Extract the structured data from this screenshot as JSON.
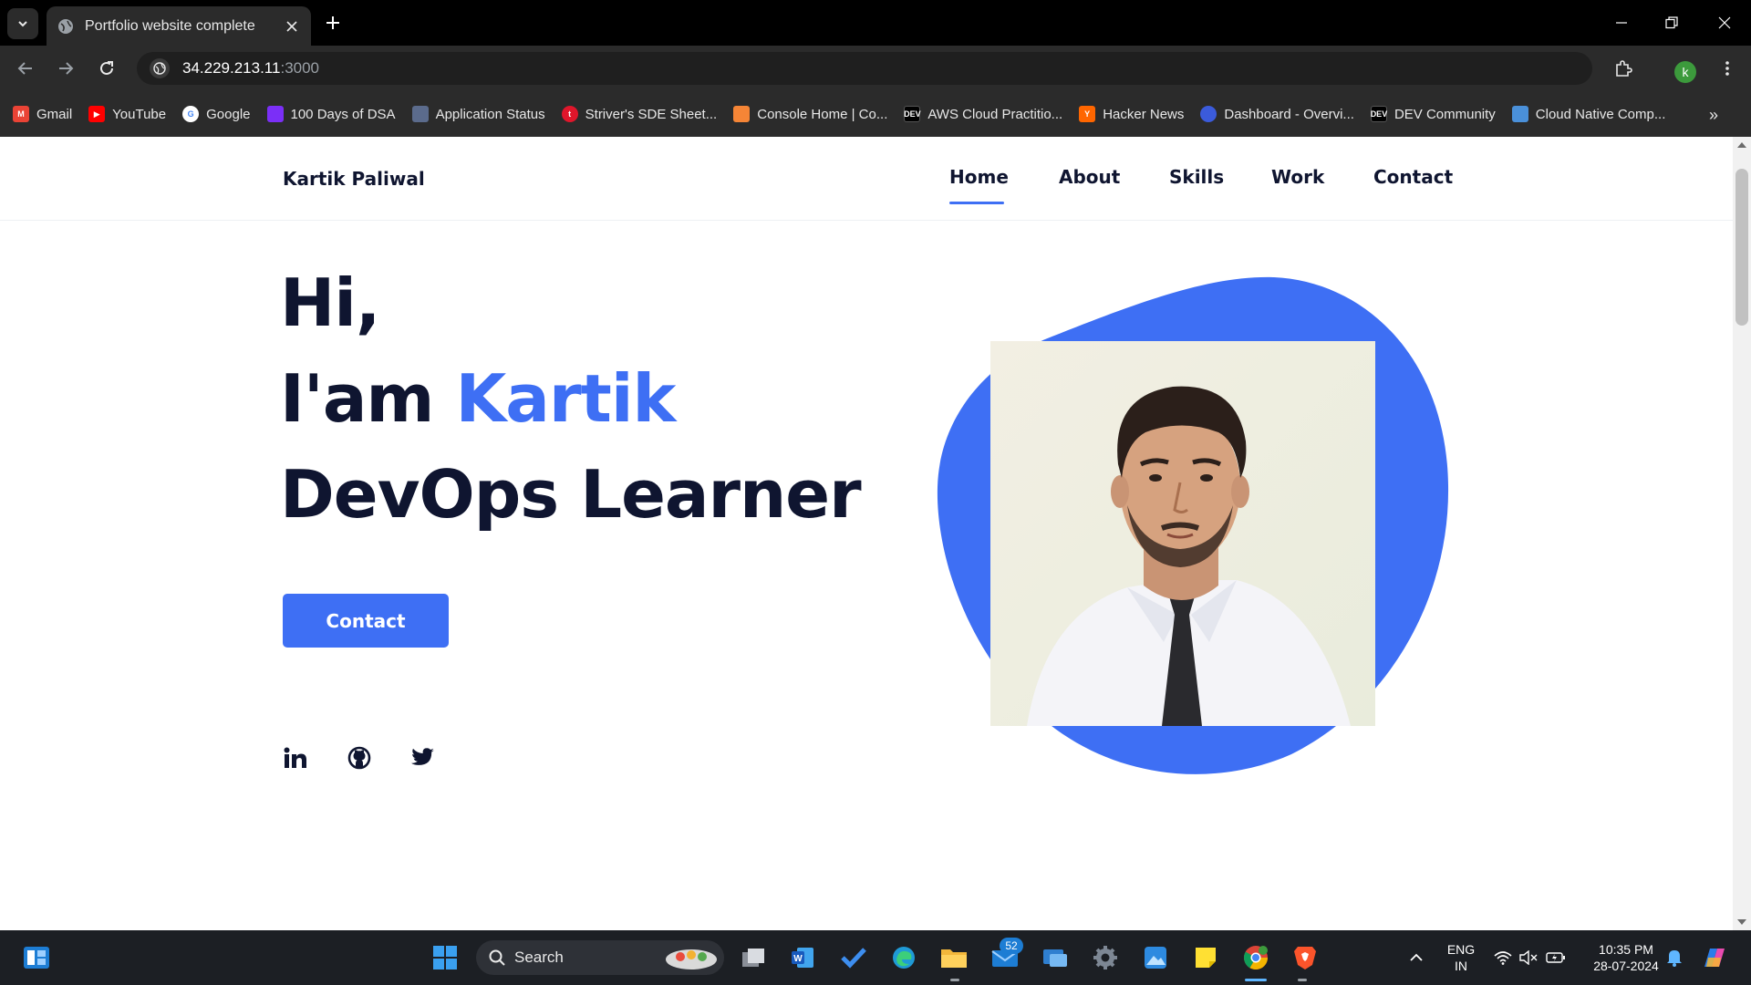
{
  "browser": {
    "tab_title": "Portfolio website complete",
    "url_host": "34.229.213.11",
    "url_port": ":3000",
    "profile_initial": "k"
  },
  "bookmarks": [
    {
      "label": "Gmail",
      "icon": "gmail-icon",
      "color": "#ea4335"
    },
    {
      "label": "YouTube",
      "icon": "youtube-icon",
      "color": "#ff0000"
    },
    {
      "label": "Google",
      "icon": "google-icon",
      "color": "#4285f4"
    },
    {
      "label": "100 Days of DSA",
      "icon": "dsa-icon",
      "color": "#7b2ff7"
    },
    {
      "label": "Application Status",
      "icon": "application-status-icon",
      "color": "#5b6b8c"
    },
    {
      "label": "Striver's SDE Sheet...",
      "icon": "tuf-icon",
      "color": "#e0162b"
    },
    {
      "label": "Console Home | Co...",
      "icon": "aws-cube-icon",
      "color": "#f58536"
    },
    {
      "label": "AWS Cloud Practitio...",
      "icon": "dev-icon",
      "color": "#000000"
    },
    {
      "label": "Hacker News",
      "icon": "hacker-news-icon",
      "color": "#ff6600"
    },
    {
      "label": "Dashboard - Overvi...",
      "icon": "dashboard-icon",
      "color": "#3b5bdb"
    },
    {
      "label": "DEV Community",
      "icon": "dev-icon",
      "color": "#000000"
    },
    {
      "label": "Cloud Native Comp...",
      "icon": "cncf-icon",
      "color": "#4a90d9"
    }
  ],
  "page": {
    "logo": "Kartik Paliwal",
    "nav": [
      "Home",
      "About",
      "Skills",
      "Work",
      "Contact"
    ],
    "active_nav": "Home",
    "hero": {
      "line1": "Hi,",
      "line2_prefix": "I'am ",
      "line2_name": "Kartik",
      "line3": "DevOps Learner"
    },
    "contact_button": "Contact",
    "social": [
      "linkedin-icon",
      "github-icon",
      "twitter-icon"
    ],
    "accent_color": "#3e6ff4",
    "text_color": "#0f1530"
  },
  "taskbar": {
    "search_label": "Search",
    "mail_badge": "52",
    "lang_line1": "ENG",
    "lang_line2": "IN",
    "time": "10:35 PM",
    "date": "28-07-2024"
  }
}
